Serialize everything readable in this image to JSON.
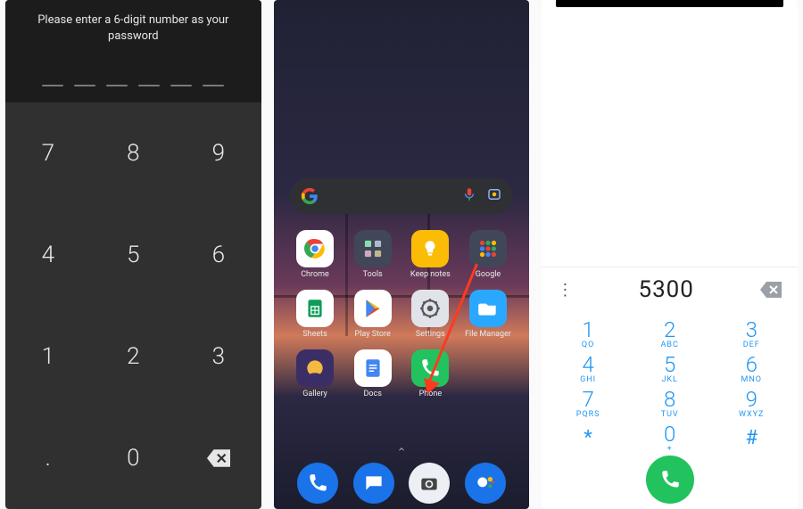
{
  "pin": {
    "prompt": "Please enter a 6-digit number as your password",
    "digits": 6,
    "keys": [
      "7",
      "8",
      "9",
      "4",
      "5",
      "6",
      "1",
      "2",
      "3",
      ".",
      "0",
      "⌫"
    ]
  },
  "home": {
    "search": {
      "provider": "Google"
    },
    "apps": [
      {
        "label": "Chrome",
        "icon": "chrome"
      },
      {
        "label": "Tools",
        "icon": "tools-folder"
      },
      {
        "label": "Keep notes",
        "icon": "keep"
      },
      {
        "label": "Google",
        "icon": "google-folder"
      },
      {
        "label": "Sheets",
        "icon": "sheets"
      },
      {
        "label": "Play Store",
        "icon": "play"
      },
      {
        "label": "Settings",
        "icon": "settings"
      },
      {
        "label": "File Manager",
        "icon": "files"
      },
      {
        "label": "Gallery",
        "icon": "gallery"
      },
      {
        "label": "Docs",
        "icon": "docs"
      },
      {
        "label": "Phone",
        "icon": "phone-green"
      }
    ],
    "dock": [
      {
        "icon": "phone-blue"
      },
      {
        "icon": "messages"
      },
      {
        "icon": "camera"
      },
      {
        "icon": "assistant"
      }
    ],
    "annotation": "arrow-to-phone"
  },
  "dialer": {
    "entered": "5300",
    "keys": [
      {
        "n": "1",
        "s": "QO"
      },
      {
        "n": "2",
        "s": "ABC"
      },
      {
        "n": "3",
        "s": "DEF"
      },
      {
        "n": "4",
        "s": "GHI"
      },
      {
        "n": "5",
        "s": "JKL"
      },
      {
        "n": "6",
        "s": "MNO"
      },
      {
        "n": "7",
        "s": "PQRS"
      },
      {
        "n": "8",
        "s": "TUV"
      },
      {
        "n": "9",
        "s": "WXYZ"
      },
      {
        "n": "*",
        "s": ""
      },
      {
        "n": "0",
        "s": "+"
      },
      {
        "n": "#",
        "s": ""
      }
    ]
  }
}
